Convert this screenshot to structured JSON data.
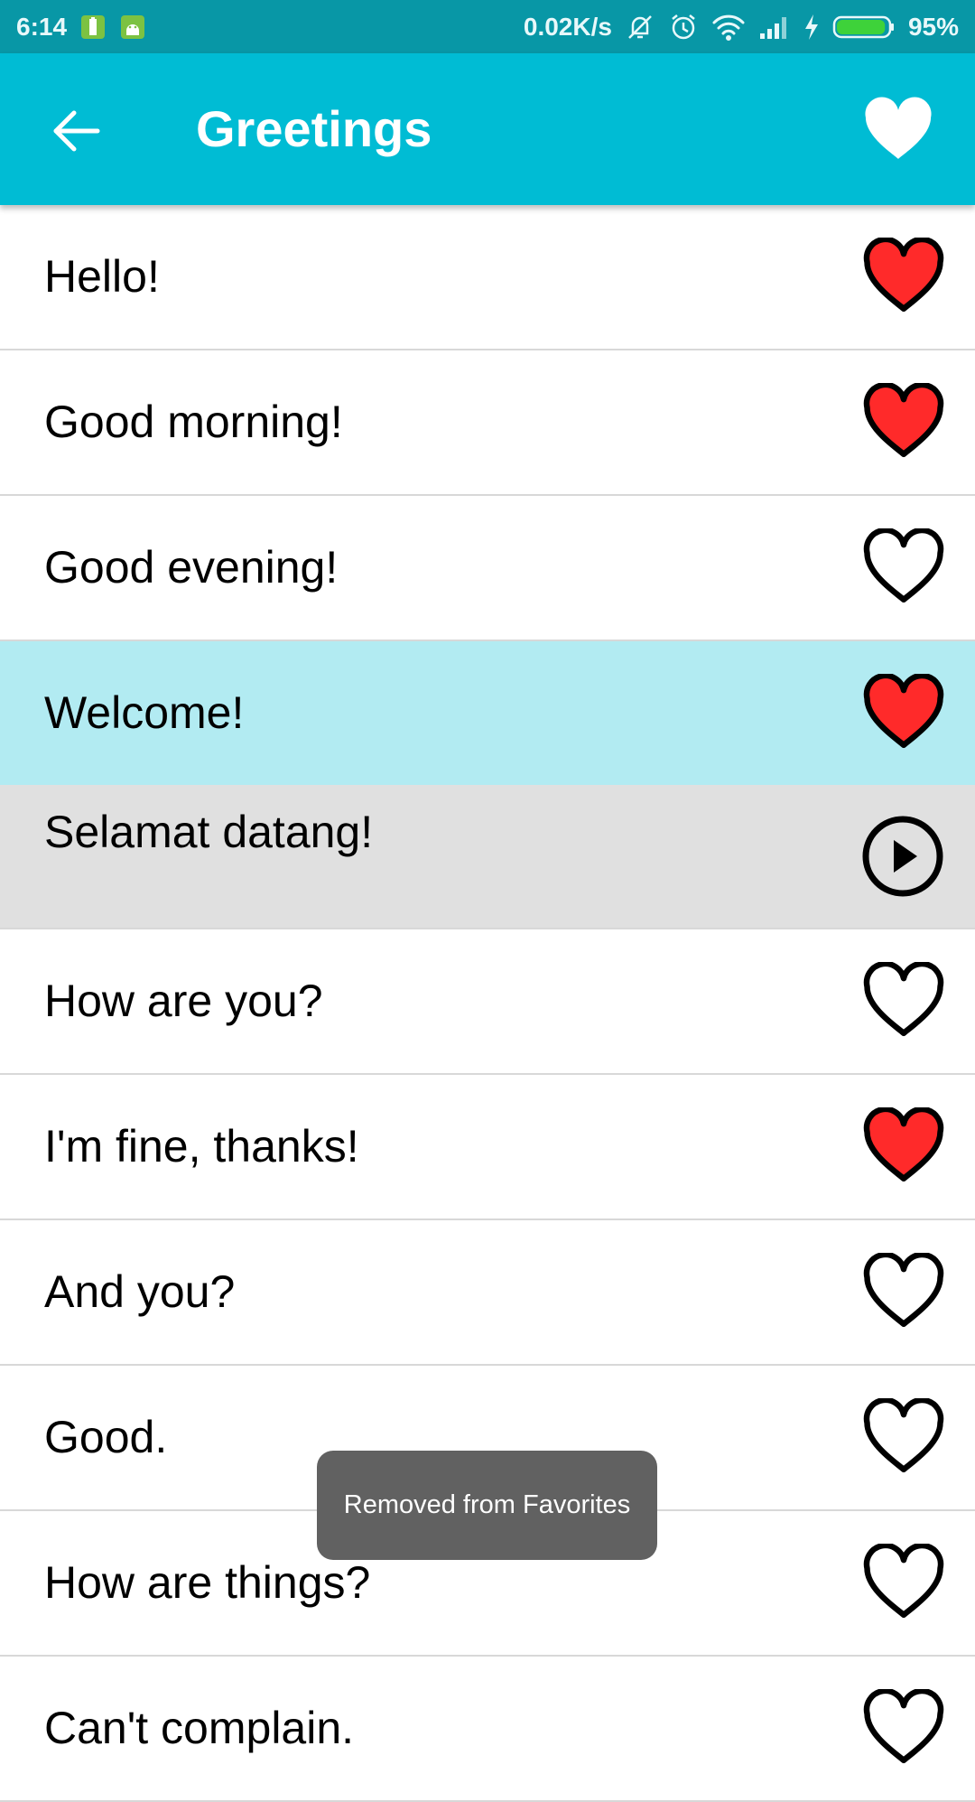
{
  "status_bar": {
    "time": "6:14",
    "network_speed": "0.02K/s",
    "battery_percent": "95%",
    "battery_level": 0.95
  },
  "app_bar": {
    "title": "Greetings",
    "background": "#00bcd4"
  },
  "colors": {
    "favorite": "#ff2a2a",
    "highlight": "#b2ebf2",
    "translation_bg": "#e0e0e0"
  },
  "list": {
    "items": [
      {
        "label": "Hello!",
        "favorite": true
      },
      {
        "label": "Good morning!",
        "favorite": true
      },
      {
        "label": "Good evening!",
        "favorite": false
      },
      {
        "label": "Welcome!",
        "favorite": true,
        "selected": true
      },
      {
        "label": "How are you?",
        "favorite": false
      },
      {
        "label": "I'm fine, thanks!",
        "favorite": true
      },
      {
        "label": "And you?",
        "favorite": false
      },
      {
        "label": "Good.",
        "favorite": false
      },
      {
        "label": "How are things?",
        "favorite": false
      },
      {
        "label": "Can't complain.",
        "favorite": false
      }
    ],
    "translation": "Selamat datang!"
  },
  "toast": {
    "message": "Removed from Favorites"
  }
}
